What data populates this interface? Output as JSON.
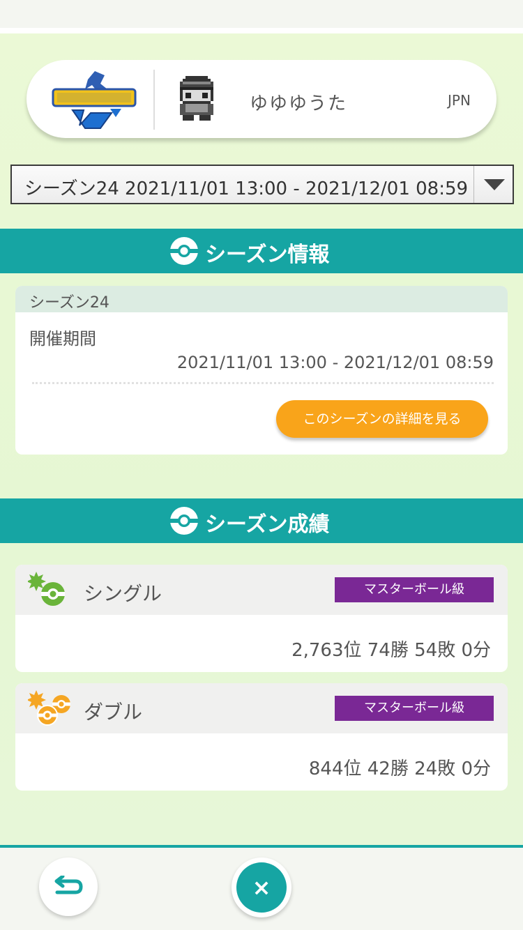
{
  "profile": {
    "game_logo": "ポケットモンスター ソード",
    "player_name": "ゆゆゆうた",
    "region": "JPN"
  },
  "season_select": {
    "selected": "シーズン24 2021/11/01 13:00 - 2021/12/01 08:59"
  },
  "season_info": {
    "header": "シーズン情報",
    "season_name": "シーズン24",
    "period_label": "開催期間",
    "period_value": "2021/11/01 13:00 - 2021/12/01 08:59",
    "detail_button": "このシーズンの詳細を見る"
  },
  "season_results": {
    "header": "シーズン成績",
    "single": {
      "name": "シングル",
      "rank_class": "マスターボール級",
      "result": "2,763位 74勝 54敗 0分"
    },
    "double": {
      "name": "ダブル",
      "rank_class": "マスターボール級",
      "result": "844位 42勝 24敗 0分"
    }
  },
  "footer": {
    "back_icon": "return-arrow-icon",
    "close_icon": "close-icon",
    "close_glyph": "×"
  },
  "colors": {
    "teal": "#16a5a3",
    "orange": "#f9a41a",
    "purple": "#7a2895",
    "single_green": "#6ab43a",
    "double_orange": "#f5a623"
  }
}
